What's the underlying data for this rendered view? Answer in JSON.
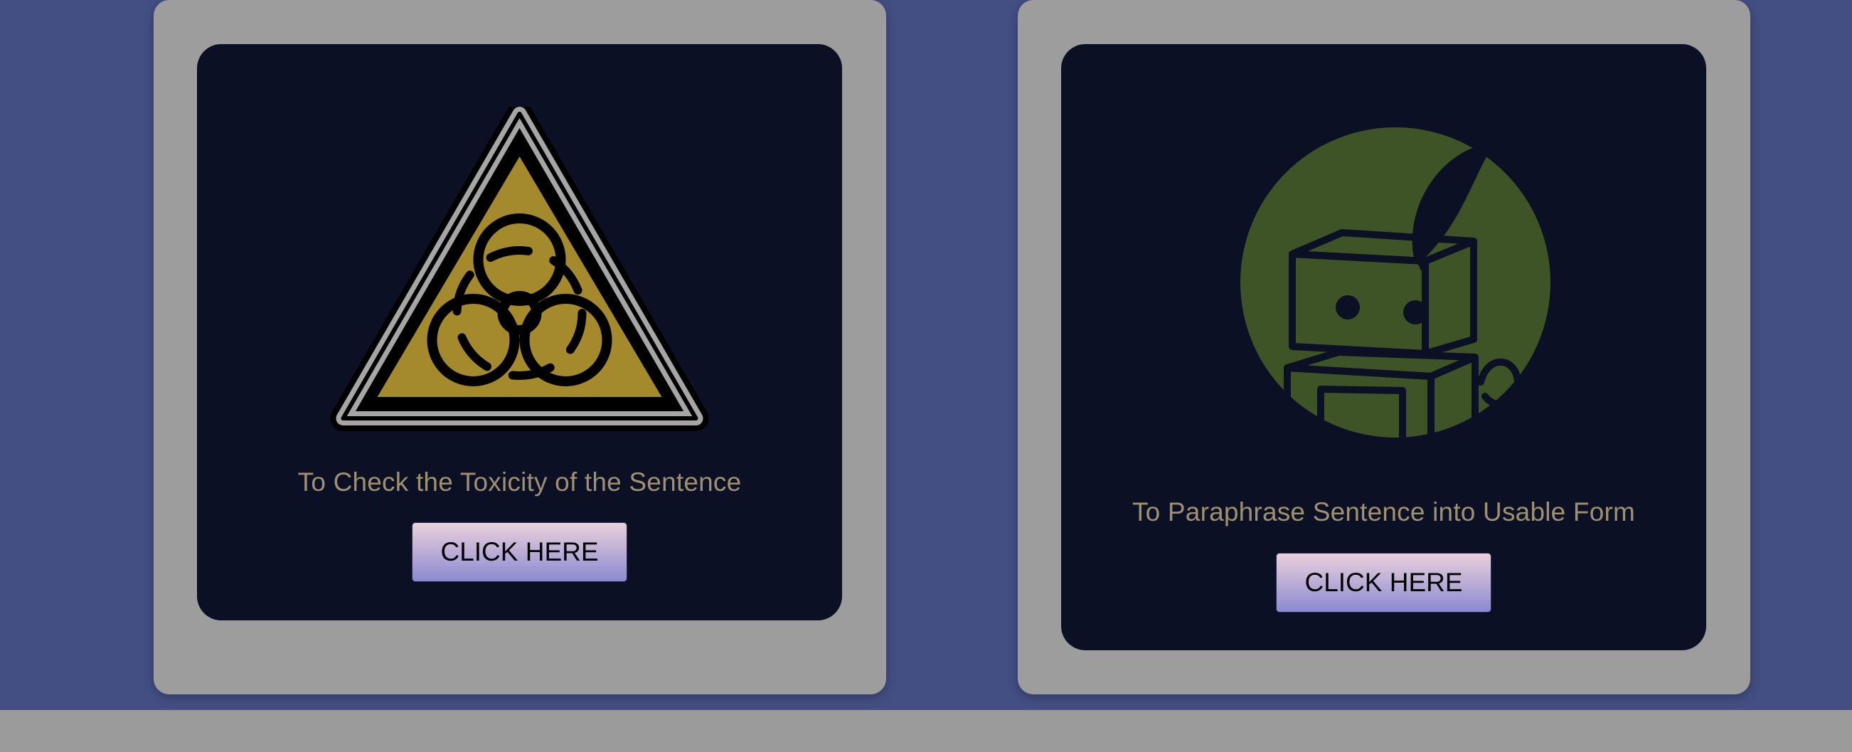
{
  "cards": [
    {
      "icon": "biohazard-warning-icon",
      "caption": "To Check the Toxicity of the Sentence",
      "button_label": "CLICK HERE"
    },
    {
      "icon": "robot-quill-icon",
      "caption": "To Paraphrase Sentence into Usable Form",
      "button_label": "CLICK HERE"
    }
  ],
  "colors": {
    "page_background": "#434e83",
    "outer_card": "#9d9d9d",
    "inner_card": "#0b1024",
    "caption_text": "#9e9070",
    "warning_yellow": "#a58a2d",
    "robot_circle": "#3f5426"
  }
}
